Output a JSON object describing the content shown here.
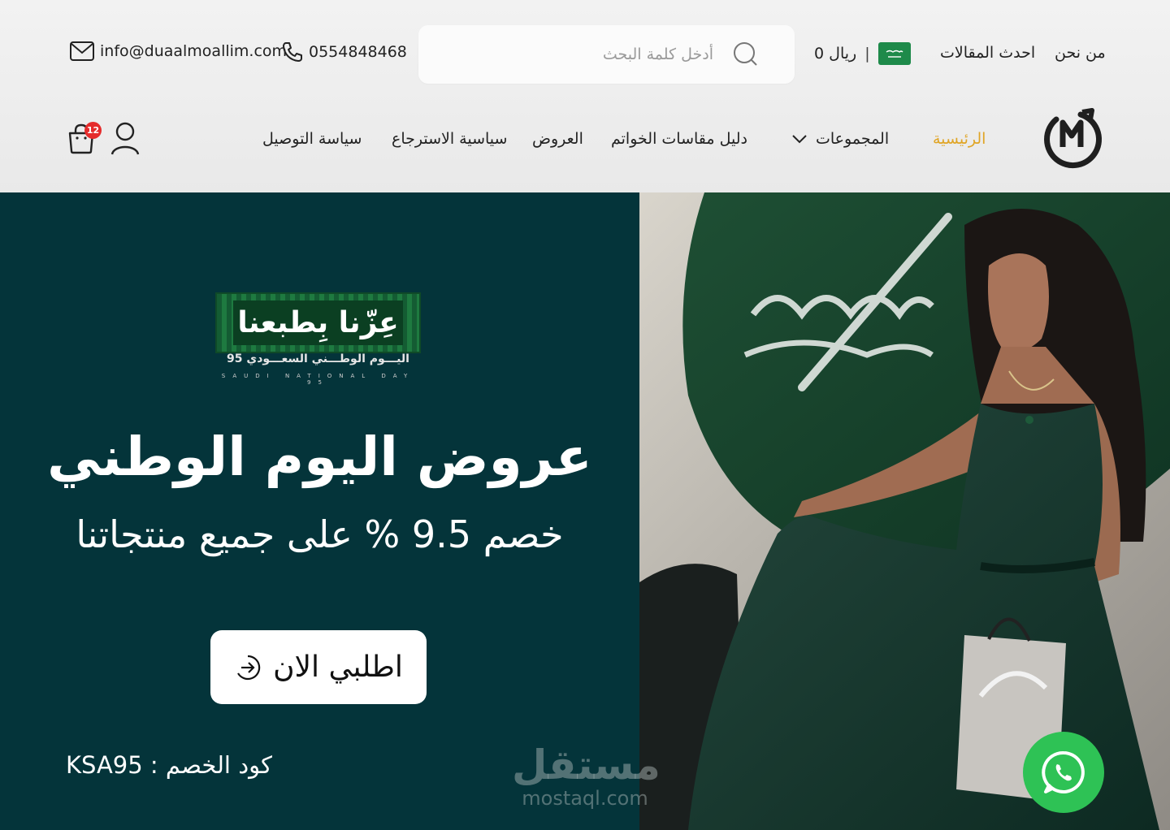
{
  "header": {
    "email": "info@duaalmoallim.com",
    "phone": "0554848468",
    "search_placeholder": "أدخل كلمة البحث",
    "cart_total": "0 ريال",
    "cart_separator": "|",
    "top_links": {
      "articles": "احدث المقالات",
      "about": "من نحن"
    },
    "nav": {
      "home": "الرئيسية",
      "collections": "المجموعات",
      "ring_guide": "دليل مقاسات الخواتم",
      "offers": "العروض",
      "returns": "سياسية الاسترجاع",
      "shipping": "سياسة التوصيل"
    },
    "cart_count": "12",
    "accent_color": "#e0a526"
  },
  "hero": {
    "badge_title": "عِزّنا بِطبعنا",
    "badge_subtitle": "اليـــوم الوطـــني السعـــودي 95",
    "badge_caption": "SAUDI NATIONAL DAY 95",
    "title": "عروض اليوم الوطني",
    "subtitle": "خصم 9.5 % على جميع منتجاتنا",
    "cta_label": "اطلبي الان",
    "discount_code": "كود الخصم : KSA95",
    "background_color": "#04343a"
  },
  "watermark": {
    "ar": "مستقل",
    "en": "mostaql.com"
  },
  "icons": {
    "email": "mail-icon",
    "phone": "phone-icon",
    "search": "search-icon",
    "flag": "saudi-flag-icon",
    "user": "user-icon",
    "cart": "shopping-bag-icon",
    "whatsapp": "whatsapp-icon",
    "arrow": "arrow-right-circle-icon",
    "chevron": "chevron-down-icon"
  }
}
